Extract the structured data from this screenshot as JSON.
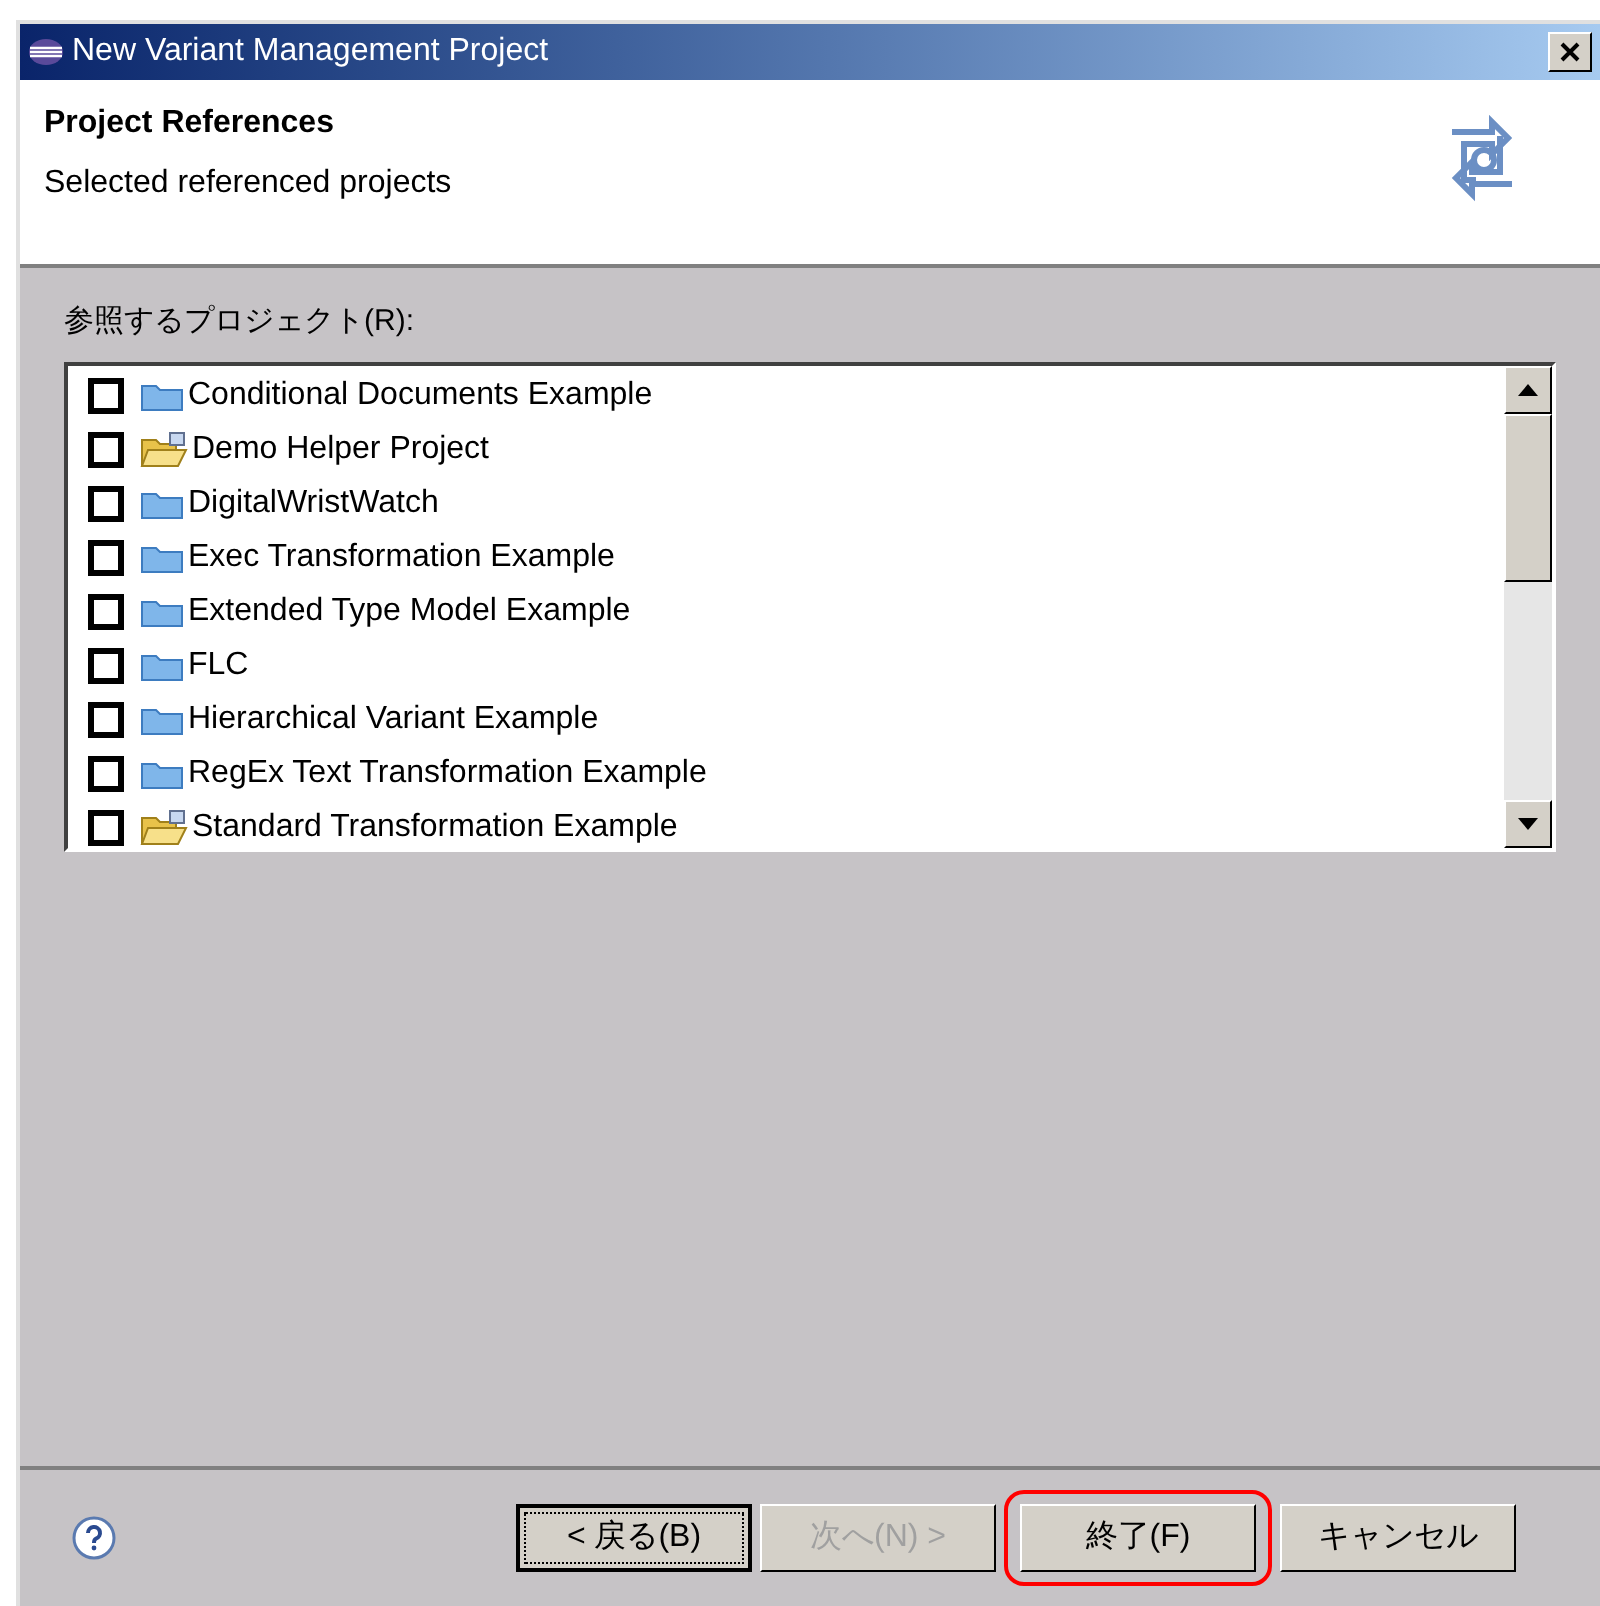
{
  "window": {
    "title": "New Variant Management Project"
  },
  "header": {
    "title": "Project References",
    "description": "Selected referenced projects"
  },
  "list_label": "参照するプロジェクト(R):",
  "projects": [
    {
      "name": "Conditional Documents Example",
      "checked": false,
      "kind": "folder"
    },
    {
      "name": "Demo Helper Project",
      "checked": false,
      "kind": "open"
    },
    {
      "name": "DigitalWristWatch",
      "checked": false,
      "kind": "folder"
    },
    {
      "name": "Exec Transformation Example",
      "checked": false,
      "kind": "folder"
    },
    {
      "name": "Extended Type Model Example",
      "checked": false,
      "kind": "folder"
    },
    {
      "name": "FLC",
      "checked": false,
      "kind": "folder"
    },
    {
      "name": "Hierarchical Variant Example",
      "checked": false,
      "kind": "folder"
    },
    {
      "name": "RegEx Text Transformation Example",
      "checked": false,
      "kind": "folder"
    },
    {
      "name": "Standard Transformation Example",
      "checked": false,
      "kind": "open"
    }
  ],
  "buttons": [
    {
      "label": "< 戻る(B)",
      "disabled": false,
      "focused": true,
      "highlighted": false
    },
    {
      "label": "次へ(N) >",
      "disabled": true,
      "focused": false,
      "highlighted": false
    },
    {
      "label": "終了(F)",
      "disabled": false,
      "focused": false,
      "highlighted": true
    },
    {
      "label": "キャンセル",
      "disabled": false,
      "focused": false,
      "highlighted": false
    }
  ]
}
